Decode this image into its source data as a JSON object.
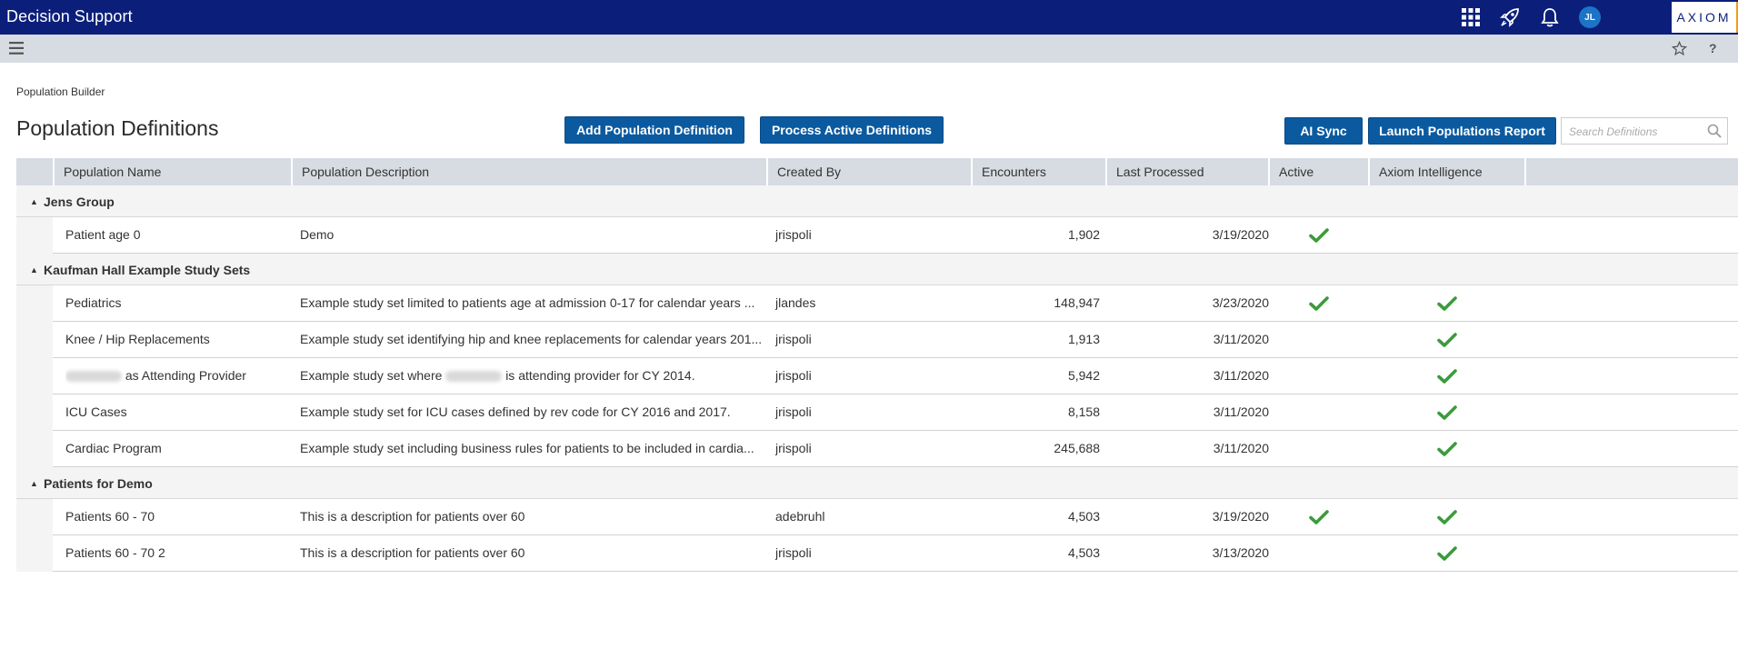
{
  "app": {
    "title": "Decision Support",
    "brand": "AXIOM",
    "user_initials": "JL"
  },
  "icons": {
    "apps": "grid-icon",
    "launch": "rocket-icon",
    "notifications": "bell-icon",
    "menu": "hamburger-icon",
    "favorite": "star-icon",
    "help": "help-icon",
    "search": "search-icon",
    "check": "checkmark-icon"
  },
  "colors": {
    "topbar": "#0b1f7a",
    "button": "#0b5aa0",
    "check": "#3c9b3c",
    "header_bg": "#d6dce2"
  },
  "help_symbol": "?",
  "breadcrumb": "Population Builder",
  "page_title": "Population Definitions",
  "buttons": {
    "add": "Add Population Definition",
    "process": "Process Active Definitions",
    "ai_sync": "AI Sync",
    "launch_report": "Launch Populations Report"
  },
  "search": {
    "placeholder": "Search Definitions",
    "value": ""
  },
  "columns": [
    "Population Name",
    "Population Description",
    "Created By",
    "Encounters",
    "Last Processed",
    "Active",
    "Axiom Intelligence"
  ],
  "groups": [
    {
      "label": "Jens Group",
      "rows": [
        {
          "name": "Patient age 0",
          "description": "Demo",
          "created_by": "jrispoli",
          "encounters": "1,902",
          "last_processed": "3/19/2020",
          "active": true,
          "axiom_intelligence": false
        }
      ]
    },
    {
      "label": "Kaufman Hall Example Study Sets",
      "rows": [
        {
          "name": "Pediatrics",
          "description": "Example study set limited to patients age at admission 0-17 for calendar years ...",
          "created_by": "jlandes",
          "encounters": "148,947",
          "last_processed": "3/23/2020",
          "active": true,
          "axiom_intelligence": true
        },
        {
          "name": "Knee / Hip Replacements",
          "description": "Example study set identifying hip and knee replacements for calendar years 201...",
          "created_by": "jrispoli",
          "encounters": "1,913",
          "last_processed": "3/11/2020",
          "active": false,
          "axiom_intelligence": true
        },
        {
          "name": "as Attending Provider",
          "description_pre": "Example study set where",
          "description_post": "is attending provider for CY 2014.",
          "created_by": "jrispoli",
          "encounters": "5,942",
          "last_processed": "3/11/2020",
          "active": false,
          "axiom_intelligence": true
        },
        {
          "name": "ICU Cases",
          "description": "Example study set for ICU cases defined by rev code for CY 2016 and 2017.",
          "created_by": "jrispoli",
          "encounters": "8,158",
          "last_processed": "3/11/2020",
          "active": false,
          "axiom_intelligence": true
        },
        {
          "name": "Cardiac Program",
          "description": "Example study set including business rules for patients to be included in cardia...",
          "created_by": "jrispoli",
          "encounters": "245,688",
          "last_processed": "3/11/2020",
          "active": false,
          "axiom_intelligence": true
        }
      ]
    },
    {
      "label": "Patients for Demo",
      "rows": [
        {
          "name": "Patients 60 - 70",
          "description": "This is a description for patients over 60",
          "created_by": "adebruhl",
          "encounters": "4,503",
          "last_processed": "3/19/2020",
          "active": true,
          "axiom_intelligence": true
        },
        {
          "name": "Patients 60 - 70 2",
          "description": "This is a description for patients over 60",
          "created_by": "jrispoli",
          "encounters": "4,503",
          "last_processed": "3/13/2020",
          "active": false,
          "axiom_intelligence": true
        }
      ]
    }
  ]
}
